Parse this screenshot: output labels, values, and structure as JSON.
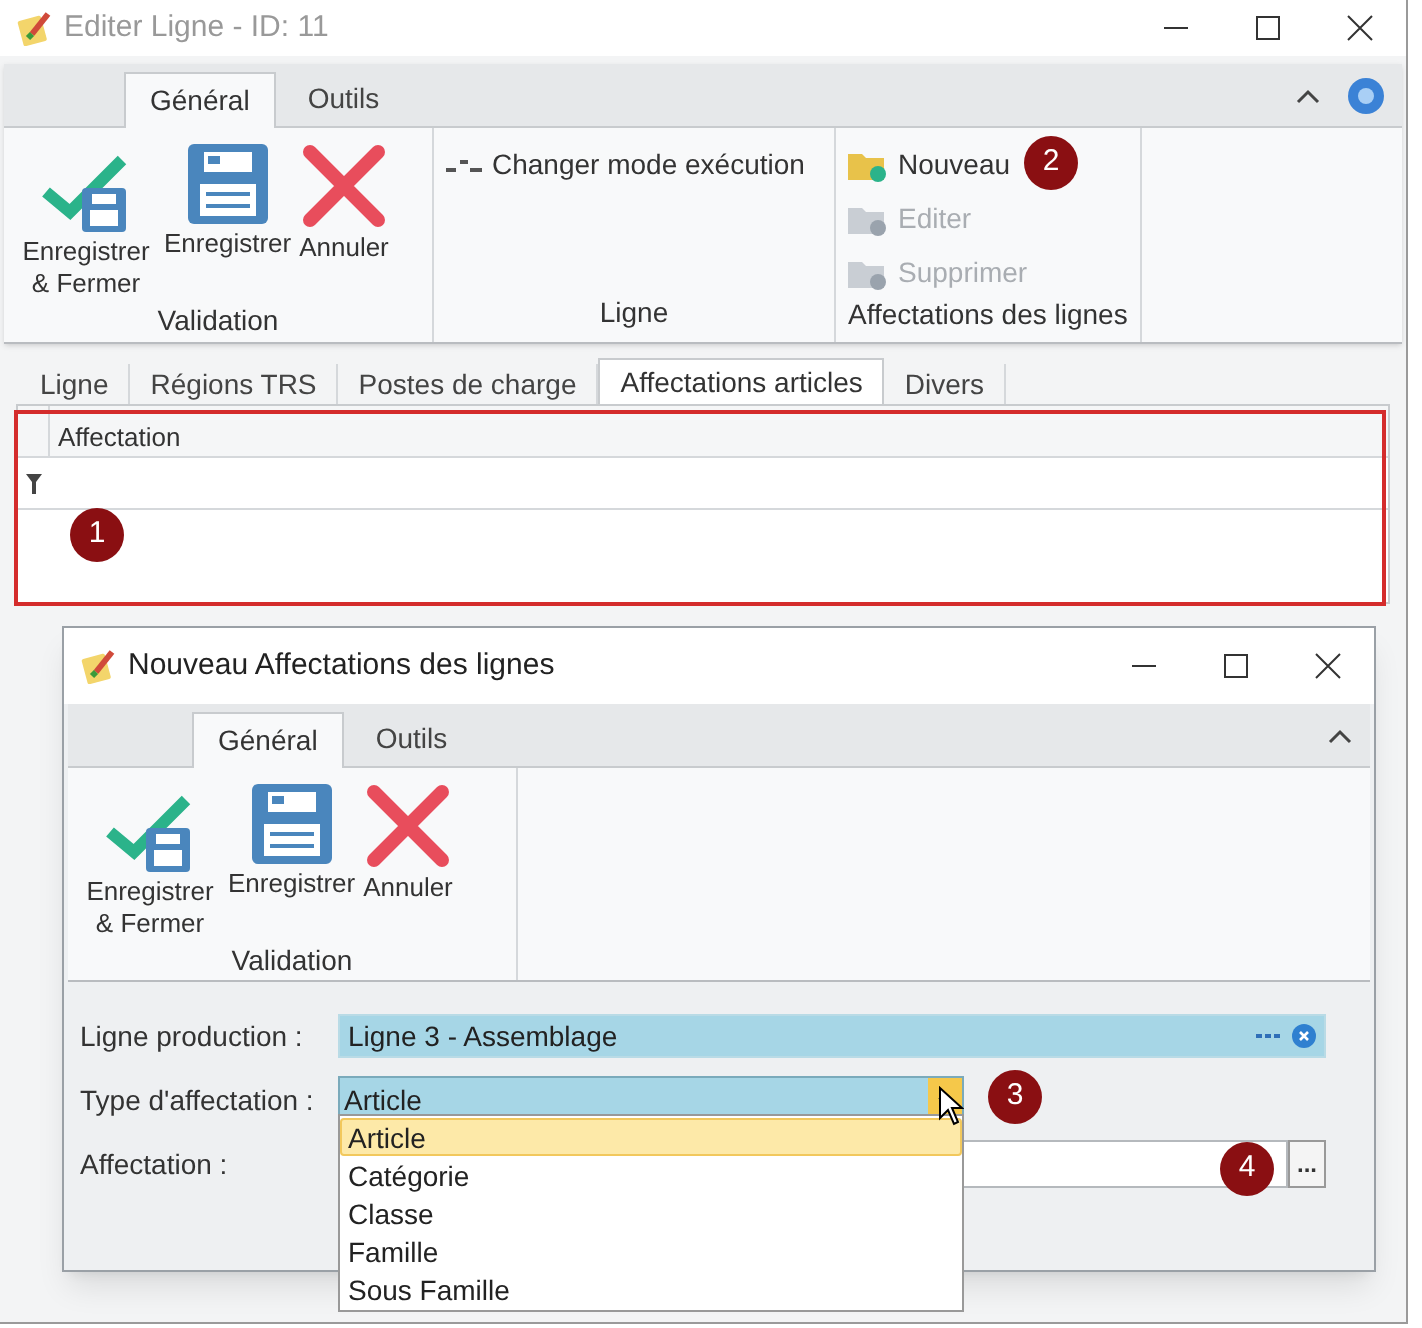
{
  "window": {
    "title": "Editer Ligne - ID: 11"
  },
  "ribbon": {
    "tabs": [
      {
        "label": "Général",
        "selected": true
      },
      {
        "label": "Outils",
        "selected": false
      }
    ],
    "groups": [
      {
        "label": "Validation",
        "kind": "large",
        "buttons": [
          {
            "label": "Enregistrer & Fermer",
            "kind": "save-close"
          },
          {
            "label": "Enregistrer",
            "kind": "save"
          },
          {
            "label": "Annuler",
            "kind": "cancel"
          }
        ]
      },
      {
        "label": "Ligne",
        "kind": "small",
        "buttons": [
          {
            "label": "Changer mode exécution",
            "kind": "mode",
            "disabled": false
          }
        ]
      },
      {
        "label": "Affectations des lignes",
        "kind": "small",
        "buttons": [
          {
            "label": "Nouveau",
            "kind": "new",
            "disabled": false
          },
          {
            "label": "Editer",
            "kind": "edit",
            "disabled": true
          },
          {
            "label": "Supprimer",
            "kind": "delete",
            "disabled": true
          }
        ]
      }
    ]
  },
  "doc_tabs": [
    {
      "label": "Ligne",
      "selected": false
    },
    {
      "label": "Régions TRS",
      "selected": false
    },
    {
      "label": "Postes de charge",
      "selected": false
    },
    {
      "label": "Affectations articles",
      "selected": true
    },
    {
      "label": "Divers",
      "selected": false
    }
  ],
  "grid": {
    "columns": [
      "Affectation"
    ]
  },
  "callouts": [
    "1",
    "2",
    "3",
    "4"
  ],
  "dialog": {
    "title": "Nouveau Affectations des lignes",
    "ribbon": {
      "tabs": [
        {
          "label": "Général",
          "selected": true
        },
        {
          "label": "Outils",
          "selected": false
        }
      ],
      "groups": [
        {
          "label": "Validation",
          "kind": "large",
          "buttons": [
            {
              "label": "Enregistrer & Fermer",
              "kind": "save-close"
            },
            {
              "label": "Enregistrer",
              "kind": "save"
            },
            {
              "label": "Annuler",
              "kind": "cancel"
            }
          ]
        }
      ]
    },
    "fields": [
      {
        "label": "Ligne production :",
        "value": "Ligne 3 - Assemblage",
        "kind": "lookup"
      },
      {
        "label": "Type d'affectation :",
        "value": "Article",
        "kind": "combo",
        "expanded": true,
        "options": [
          {
            "label": "Article",
            "selected": true
          },
          {
            "label": "Catégorie",
            "selected": false
          },
          {
            "label": "Classe",
            "selected": false
          },
          {
            "label": "Famille",
            "selected": false
          },
          {
            "label": "Sous Famille",
            "selected": false
          }
        ]
      },
      {
        "label": "Affectation :",
        "kind": "browse",
        "button": "..."
      }
    ]
  }
}
